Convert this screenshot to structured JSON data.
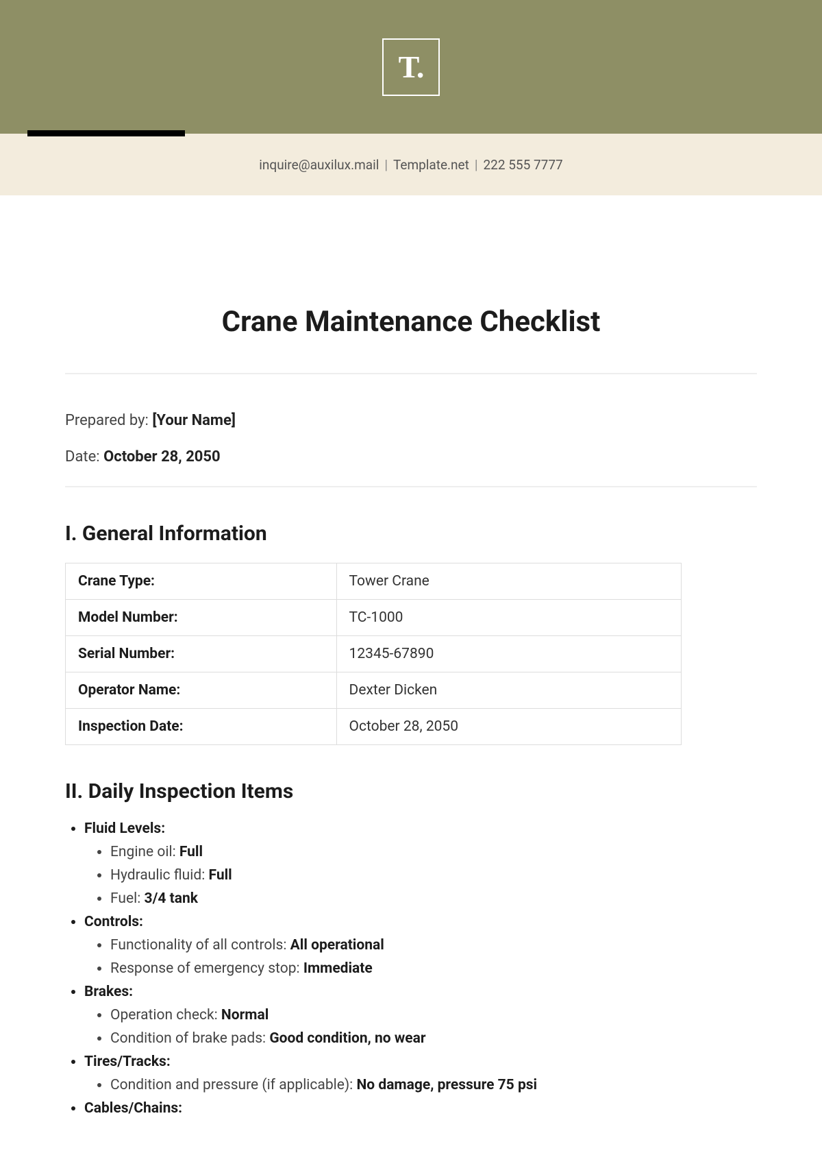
{
  "header": {
    "logo_text": "T.",
    "email": "inquire@auxilux.mail",
    "site": "Template.net",
    "phone": "222 555 7777"
  },
  "title": "Crane Maintenance Checklist",
  "meta": {
    "prepared_by_label": "Prepared by:",
    "prepared_by_value": "[Your Name]",
    "date_label": "Date:",
    "date_value": "October 28, 2050"
  },
  "section1": {
    "heading": "I. General Information",
    "rows": [
      {
        "key": "Crane Type:",
        "val": "Tower Crane"
      },
      {
        "key": "Model Number:",
        "val": "TC-1000"
      },
      {
        "key": "Serial Number:",
        "val": "12345-67890"
      },
      {
        "key": "Operator Name:",
        "val": "Dexter Dicken"
      },
      {
        "key": "Inspection Date:",
        "val": "October 28, 2050"
      }
    ]
  },
  "section2": {
    "heading": "II. Daily Inspection Items",
    "items": {
      "fluid_levels": {
        "label": "Fluid Levels:",
        "sub": [
          {
            "label": "Engine oil:",
            "val": "Full"
          },
          {
            "label": "Hydraulic fluid:",
            "val": "Full"
          },
          {
            "label": "Fuel:",
            "val": "3/4 tank"
          }
        ]
      },
      "controls": {
        "label": "Controls:",
        "sub": [
          {
            "label": "Functionality of all controls:",
            "val": "All operational"
          },
          {
            "label": "Response of emergency stop:",
            "val": "Immediate"
          }
        ]
      },
      "brakes": {
        "label": "Brakes:",
        "sub": [
          {
            "label": "Operation check:",
            "val": "Normal"
          },
          {
            "label": "Condition of brake pads:",
            "val": "Good condition, no wear"
          }
        ]
      },
      "tires": {
        "label": "Tires/Tracks:",
        "sub": [
          {
            "label": "Condition and pressure (if applicable):",
            "val": "No damage, pressure 75 psi"
          }
        ]
      },
      "cables": {
        "label": "Cables/Chains:"
      }
    }
  }
}
